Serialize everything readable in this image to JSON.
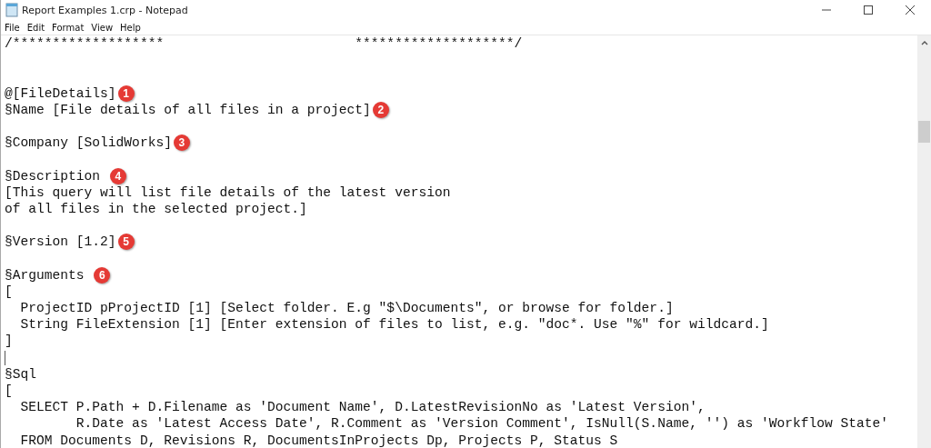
{
  "window": {
    "title": "Report Examples 1.crp - Notepad"
  },
  "menu": [
    "File",
    "Edit",
    "Format",
    "View",
    "Help"
  ],
  "lines": [
    {
      "kind": "text",
      "text": "/*******************                        ********************/"
    },
    {
      "kind": "blank"
    },
    {
      "kind": "blank"
    },
    {
      "kind": "text",
      "text": "@[FileDetails]",
      "badge": "1"
    },
    {
      "kind": "text",
      "text": "§Name [File details of all files in a project]",
      "badge": "2"
    },
    {
      "kind": "blank"
    },
    {
      "kind": "text",
      "text": "§Company [SolidWorks]",
      "badge": "3"
    },
    {
      "kind": "blank"
    },
    {
      "kind": "text",
      "text": "§Description ",
      "badge": "4"
    },
    {
      "kind": "text",
      "text": "[This query will list file details of the latest version"
    },
    {
      "kind": "text",
      "text": "of all files in the selected project.]"
    },
    {
      "kind": "blank"
    },
    {
      "kind": "text",
      "text": "§Version [1.2]",
      "badge": "5"
    },
    {
      "kind": "blank"
    },
    {
      "kind": "text",
      "text": "§Arguments ",
      "badge": "6"
    },
    {
      "kind": "text",
      "text": "["
    },
    {
      "kind": "text",
      "text": "  ProjectID pProjectID [1] [Select folder. E.g \"$\\Documents\", or browse for folder.]"
    },
    {
      "kind": "text",
      "text": "  String FileExtension [1] [Enter extension of files to list, e.g. \"doc*. Use \"%\" for wildcard.]"
    },
    {
      "kind": "text",
      "text": "]"
    },
    {
      "kind": "cursor"
    },
    {
      "kind": "text",
      "text": "§Sql"
    },
    {
      "kind": "text",
      "text": "["
    },
    {
      "kind": "text",
      "text": "  SELECT P.Path + D.Filename as 'Document Name', D.LatestRevisionNo as 'Latest Version',"
    },
    {
      "kind": "text",
      "text": "         R.Date as 'Latest Access Date', R.Comment as 'Version Comment', IsNull(S.Name, '') as 'Workflow State'"
    },
    {
      "kind": "text",
      "text": "  FROM Documents D, Revisions R, DocumentsInProjects Dp, Projects P, Status S"
    }
  ]
}
